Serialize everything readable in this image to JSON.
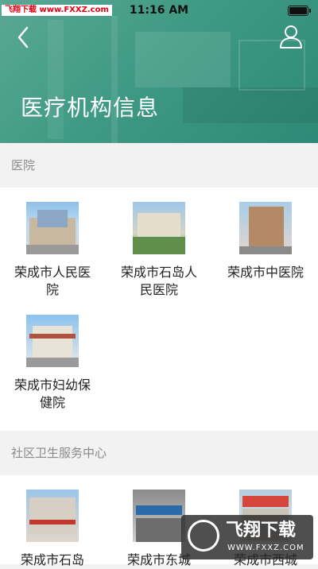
{
  "status": {
    "time": "11:16 AM",
    "watermark": "飞翔下载 www.FXXZ.com"
  },
  "header": {
    "title": "医疗机构信息"
  },
  "sections": [
    {
      "label": "医院",
      "items": [
        {
          "name": "荣成市人民医院"
        },
        {
          "name": "荣成市石岛人民医院"
        },
        {
          "name": "荣成市中医院"
        },
        {
          "name": "荣成市妇幼保健院"
        }
      ]
    },
    {
      "label": "社区卫生服务中心",
      "items": [
        {
          "name": "荣成市石岛"
        },
        {
          "name": "荣成市东城"
        },
        {
          "name": "荣成市西城"
        }
      ]
    }
  ],
  "footer_watermark": {
    "brand": "飞翔下载",
    "url": "WWW.FXXZ.COM"
  },
  "colors": {
    "header": "#3f9a84",
    "section_bg": "#f2f2f2",
    "card_bg": "#ffffff"
  }
}
